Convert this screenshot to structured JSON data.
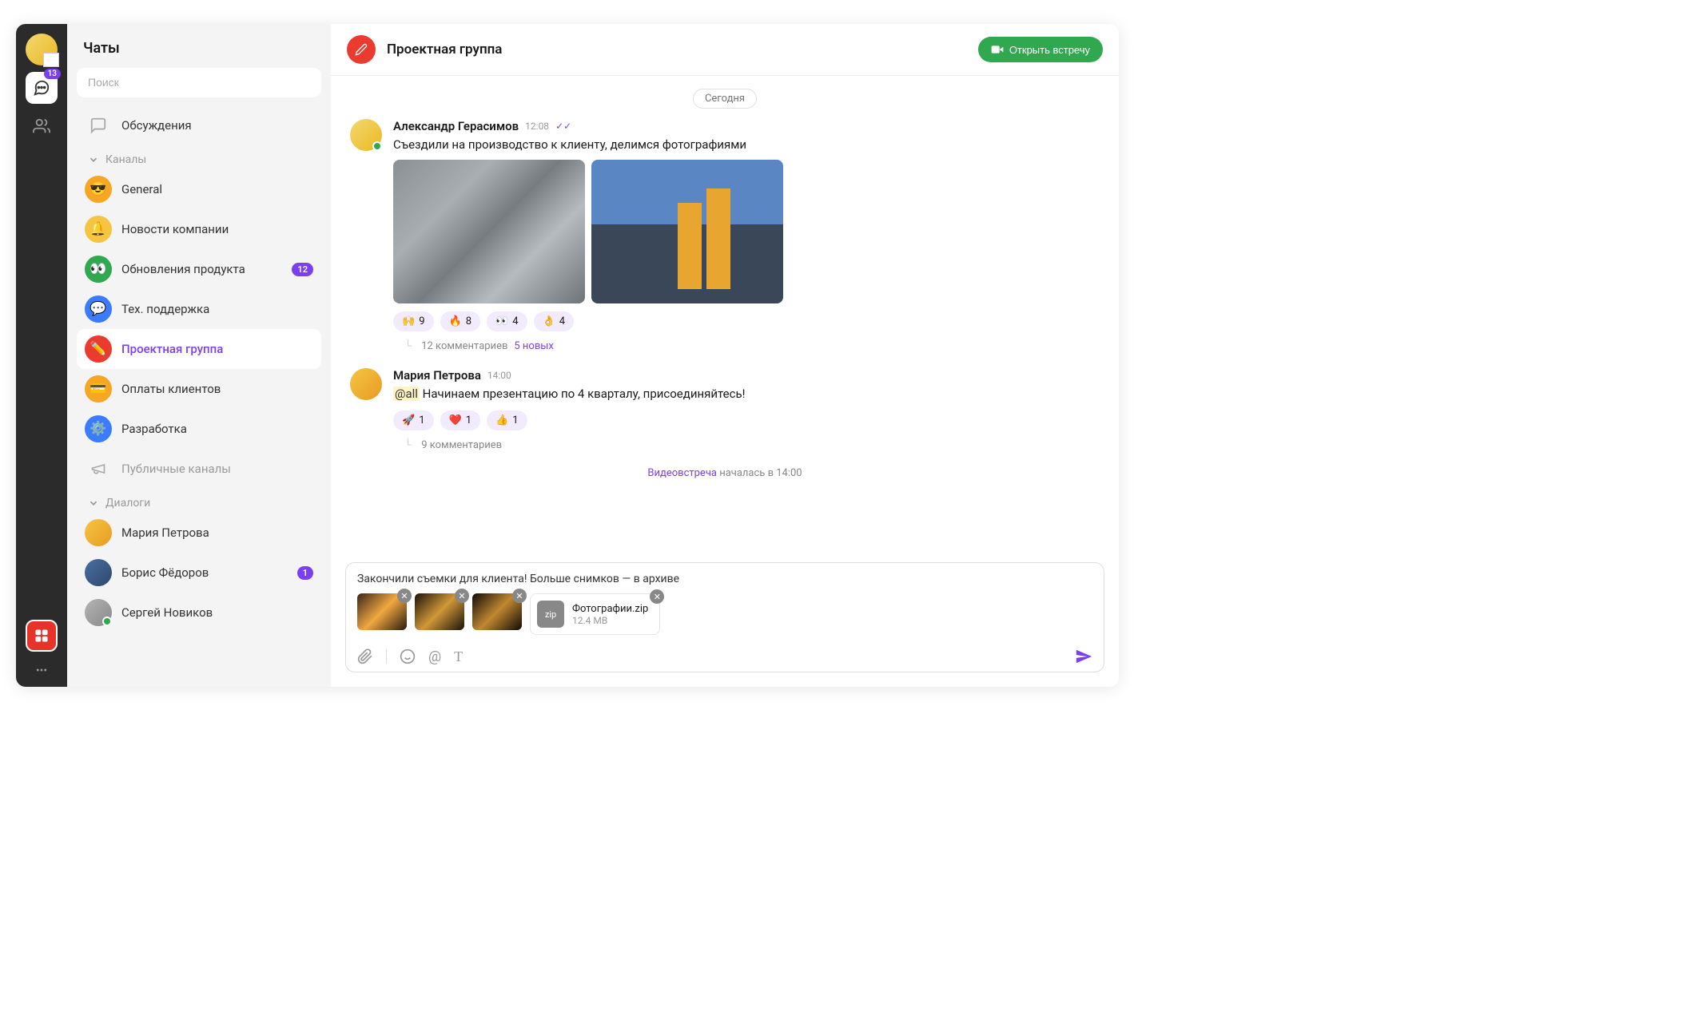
{
  "rail": {
    "chat_badge": "13"
  },
  "sidebar": {
    "title": "Чаты",
    "search_placeholder": "Поиск",
    "discussions": "Обсуждения",
    "channels_section": "Каналы",
    "channels": [
      {
        "label": "General",
        "emoji": "😎",
        "color": "#f5a623"
      },
      {
        "label": "Новости компании",
        "emoji": "🔔",
        "color": "#f5c542"
      },
      {
        "label": "Обновления продукта",
        "emoji": "👀",
        "color": "#2fa84f",
        "badge": "12"
      },
      {
        "label": "Тех. поддержка",
        "emoji": "💬",
        "color": "#3b7cff"
      },
      {
        "label": "Проектная группа",
        "emoji": "✏️",
        "color": "#eb3b2f",
        "active": true
      },
      {
        "label": "Оплаты клиентов",
        "emoji": "💳",
        "color": "#f5a623"
      },
      {
        "label": "Разработка",
        "emoji": "⚙️",
        "color": "#3b7cff"
      }
    ],
    "public_channels": "Публичные каналы",
    "dialogs_section": "Диалоги",
    "dialogs": [
      {
        "label": "Мария Петрова",
        "color": "#f5a623"
      },
      {
        "label": "Борис Фёдоров",
        "color": "#3b7cff",
        "badge": "1"
      },
      {
        "label": "Сергей Новиков",
        "color": "#999",
        "online": true
      }
    ]
  },
  "chat": {
    "title": "Проектная группа",
    "open_meeting": "Открыть встречу",
    "date": "Сегодня",
    "messages": [
      {
        "author": "Александр Герасимов",
        "time": "12:08",
        "read": true,
        "text": "Съездили на производство к клиенту, делимся фотографиями",
        "reactions": [
          {
            "emoji": "🙌",
            "count": "9"
          },
          {
            "emoji": "🔥",
            "count": "8"
          },
          {
            "emoji": "👀",
            "count": "4"
          },
          {
            "emoji": "👌",
            "count": "4"
          }
        ],
        "comments": "12 комментариев",
        "new_comments": "5 новых"
      },
      {
        "author": "Мария Петрова",
        "time": "14:00",
        "mention": "@all",
        "text": "Начинаем презентацию по 4 кварталу, присоединяйтесь!",
        "reactions": [
          {
            "emoji": "🚀",
            "count": "1"
          },
          {
            "emoji": "❤️",
            "count": "1"
          },
          {
            "emoji": "👍",
            "count": "1"
          }
        ],
        "comments": "9 комментариев"
      }
    ],
    "video_note_link": "Видеовстреча",
    "video_note_text": " началась в 14:00"
  },
  "composer": {
    "text": "Закончили съемки для клиента! Больше снимков — в архиве",
    "file_name": "Фотографии.zip",
    "file_size": "12.4 MB",
    "file_ext": "zip"
  }
}
